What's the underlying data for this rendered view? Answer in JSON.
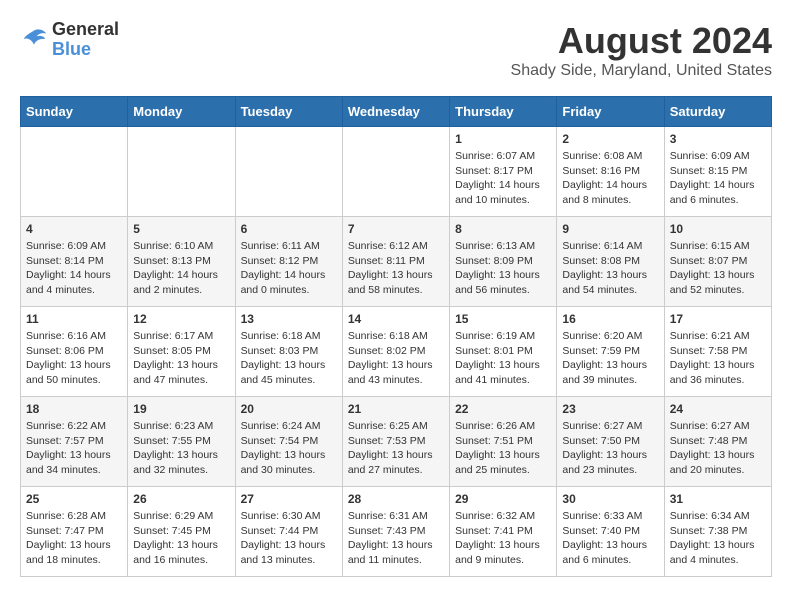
{
  "header": {
    "logo": {
      "line1": "General",
      "line2": "Blue"
    },
    "title": "August 2024",
    "subtitle": "Shady Side, Maryland, United States"
  },
  "calendar": {
    "days_of_week": [
      "Sunday",
      "Monday",
      "Tuesday",
      "Wednesday",
      "Thursday",
      "Friday",
      "Saturday"
    ],
    "weeks": [
      [
        {
          "day": "",
          "content": ""
        },
        {
          "day": "",
          "content": ""
        },
        {
          "day": "",
          "content": ""
        },
        {
          "day": "",
          "content": ""
        },
        {
          "day": "1",
          "content": "Sunrise: 6:07 AM\nSunset: 8:17 PM\nDaylight: 14 hours\nand 10 minutes."
        },
        {
          "day": "2",
          "content": "Sunrise: 6:08 AM\nSunset: 8:16 PM\nDaylight: 14 hours\nand 8 minutes."
        },
        {
          "day": "3",
          "content": "Sunrise: 6:09 AM\nSunset: 8:15 PM\nDaylight: 14 hours\nand 6 minutes."
        }
      ],
      [
        {
          "day": "4",
          "content": "Sunrise: 6:09 AM\nSunset: 8:14 PM\nDaylight: 14 hours\nand 4 minutes."
        },
        {
          "day": "5",
          "content": "Sunrise: 6:10 AM\nSunset: 8:13 PM\nDaylight: 14 hours\nand 2 minutes."
        },
        {
          "day": "6",
          "content": "Sunrise: 6:11 AM\nSunset: 8:12 PM\nDaylight: 14 hours\nand 0 minutes."
        },
        {
          "day": "7",
          "content": "Sunrise: 6:12 AM\nSunset: 8:11 PM\nDaylight: 13 hours\nand 58 minutes."
        },
        {
          "day": "8",
          "content": "Sunrise: 6:13 AM\nSunset: 8:09 PM\nDaylight: 13 hours\nand 56 minutes."
        },
        {
          "day": "9",
          "content": "Sunrise: 6:14 AM\nSunset: 8:08 PM\nDaylight: 13 hours\nand 54 minutes."
        },
        {
          "day": "10",
          "content": "Sunrise: 6:15 AM\nSunset: 8:07 PM\nDaylight: 13 hours\nand 52 minutes."
        }
      ],
      [
        {
          "day": "11",
          "content": "Sunrise: 6:16 AM\nSunset: 8:06 PM\nDaylight: 13 hours\nand 50 minutes."
        },
        {
          "day": "12",
          "content": "Sunrise: 6:17 AM\nSunset: 8:05 PM\nDaylight: 13 hours\nand 47 minutes."
        },
        {
          "day": "13",
          "content": "Sunrise: 6:18 AM\nSunset: 8:03 PM\nDaylight: 13 hours\nand 45 minutes."
        },
        {
          "day": "14",
          "content": "Sunrise: 6:18 AM\nSunset: 8:02 PM\nDaylight: 13 hours\nand 43 minutes."
        },
        {
          "day": "15",
          "content": "Sunrise: 6:19 AM\nSunset: 8:01 PM\nDaylight: 13 hours\nand 41 minutes."
        },
        {
          "day": "16",
          "content": "Sunrise: 6:20 AM\nSunset: 7:59 PM\nDaylight: 13 hours\nand 39 minutes."
        },
        {
          "day": "17",
          "content": "Sunrise: 6:21 AM\nSunset: 7:58 PM\nDaylight: 13 hours\nand 36 minutes."
        }
      ],
      [
        {
          "day": "18",
          "content": "Sunrise: 6:22 AM\nSunset: 7:57 PM\nDaylight: 13 hours\nand 34 minutes."
        },
        {
          "day": "19",
          "content": "Sunrise: 6:23 AM\nSunset: 7:55 PM\nDaylight: 13 hours\nand 32 minutes."
        },
        {
          "day": "20",
          "content": "Sunrise: 6:24 AM\nSunset: 7:54 PM\nDaylight: 13 hours\nand 30 minutes."
        },
        {
          "day": "21",
          "content": "Sunrise: 6:25 AM\nSunset: 7:53 PM\nDaylight: 13 hours\nand 27 minutes."
        },
        {
          "day": "22",
          "content": "Sunrise: 6:26 AM\nSunset: 7:51 PM\nDaylight: 13 hours\nand 25 minutes."
        },
        {
          "day": "23",
          "content": "Sunrise: 6:27 AM\nSunset: 7:50 PM\nDaylight: 13 hours\nand 23 minutes."
        },
        {
          "day": "24",
          "content": "Sunrise: 6:27 AM\nSunset: 7:48 PM\nDaylight: 13 hours\nand 20 minutes."
        }
      ],
      [
        {
          "day": "25",
          "content": "Sunrise: 6:28 AM\nSunset: 7:47 PM\nDaylight: 13 hours\nand 18 minutes."
        },
        {
          "day": "26",
          "content": "Sunrise: 6:29 AM\nSunset: 7:45 PM\nDaylight: 13 hours\nand 16 minutes."
        },
        {
          "day": "27",
          "content": "Sunrise: 6:30 AM\nSunset: 7:44 PM\nDaylight: 13 hours\nand 13 minutes."
        },
        {
          "day": "28",
          "content": "Sunrise: 6:31 AM\nSunset: 7:43 PM\nDaylight: 13 hours\nand 11 minutes."
        },
        {
          "day": "29",
          "content": "Sunrise: 6:32 AM\nSunset: 7:41 PM\nDaylight: 13 hours\nand 9 minutes."
        },
        {
          "day": "30",
          "content": "Sunrise: 6:33 AM\nSunset: 7:40 PM\nDaylight: 13 hours\nand 6 minutes."
        },
        {
          "day": "31",
          "content": "Sunrise: 6:34 AM\nSunset: 7:38 PM\nDaylight: 13 hours\nand 4 minutes."
        }
      ]
    ]
  }
}
